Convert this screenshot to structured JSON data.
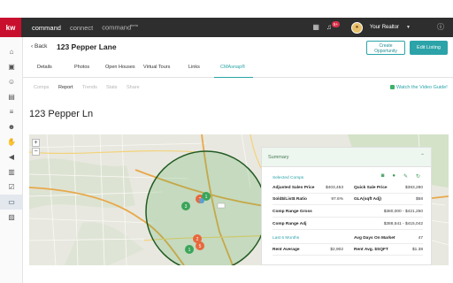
{
  "topbar": {
    "logo": "kw",
    "nav": [
      {
        "label": "command",
        "active": true
      },
      {
        "label": "connect",
        "active": false
      },
      {
        "label": "command",
        "sup": "beta",
        "active": false
      }
    ],
    "notification_count": "5+",
    "user_name": "Your Realtor",
    "icons": [
      "grid-icon",
      "bell-icon",
      "chevron-down-icon",
      "help-icon"
    ]
  },
  "sidebar": {
    "icons": [
      "home-icon",
      "contacts-icon",
      "person-icon",
      "document-icon",
      "notes-icon",
      "group-icon",
      "handshake-icon",
      "megaphone-icon",
      "bar-chart-icon",
      "checklist-icon",
      "browser-icon",
      "image-icon"
    ],
    "active_index": 10
  },
  "header": {
    "back_label": "Back",
    "title": "123 Pepper Lane",
    "create_opportunity": "Create\nOpportunity",
    "edit_listing": "Edit Listing"
  },
  "tabs": [
    "Details",
    "Photos",
    "Open Houses",
    "Virtual Tours",
    "Links",
    "CMAsnap®"
  ],
  "active_tab": "CMAsnap®",
  "subtabs": [
    "Comps",
    "Report",
    "Trends",
    "Stats",
    "Share"
  ],
  "active_subtab": "Report",
  "video_link": "Watch the Video Guide!",
  "address": "123 Pepper Ln",
  "map": {
    "zoom_in": "+",
    "zoom_out": "−",
    "pins": [
      {
        "label": "3",
        "color": "#3aa55a"
      },
      {
        "label": "2",
        "color": "#e8683c"
      },
      {
        "label": "1",
        "color": "#3aa55a"
      },
      {
        "label": "1",
        "color": "#5aa0d0"
      },
      {
        "label": "2",
        "color": "#e8683c"
      },
      {
        "label": "1",
        "color": "#3aa55a"
      },
      {
        "label": "5",
        "color": "#e8683c"
      }
    ]
  },
  "summary": {
    "title": "Summary",
    "selected_comps": "Selected Comps",
    "last_6_months": "Last 6 Months",
    "rows": [
      {
        "label": "Adjusted Sales Price",
        "value": "$403,453",
        "label2": "Quick Sale Price",
        "value2": "$383,280"
      },
      {
        "label": "Sold$/List$ Ratio",
        "value": "97.6%",
        "label2": "GLA(sqft Adj)",
        "value2": "$58"
      },
      {
        "label": "Comp Range Gross",
        "value": "$380,000 - $421,250"
      },
      {
        "label": "Comp Range Adj",
        "value": "$388,541 - $415,042"
      },
      {
        "label": "Avg Days On Market",
        "value": "47"
      },
      {
        "label": "Rent Average",
        "value": "$2,902",
        "label2": "Rent Avg. $SQFT",
        "value2": "$1.38"
      }
    ]
  }
}
